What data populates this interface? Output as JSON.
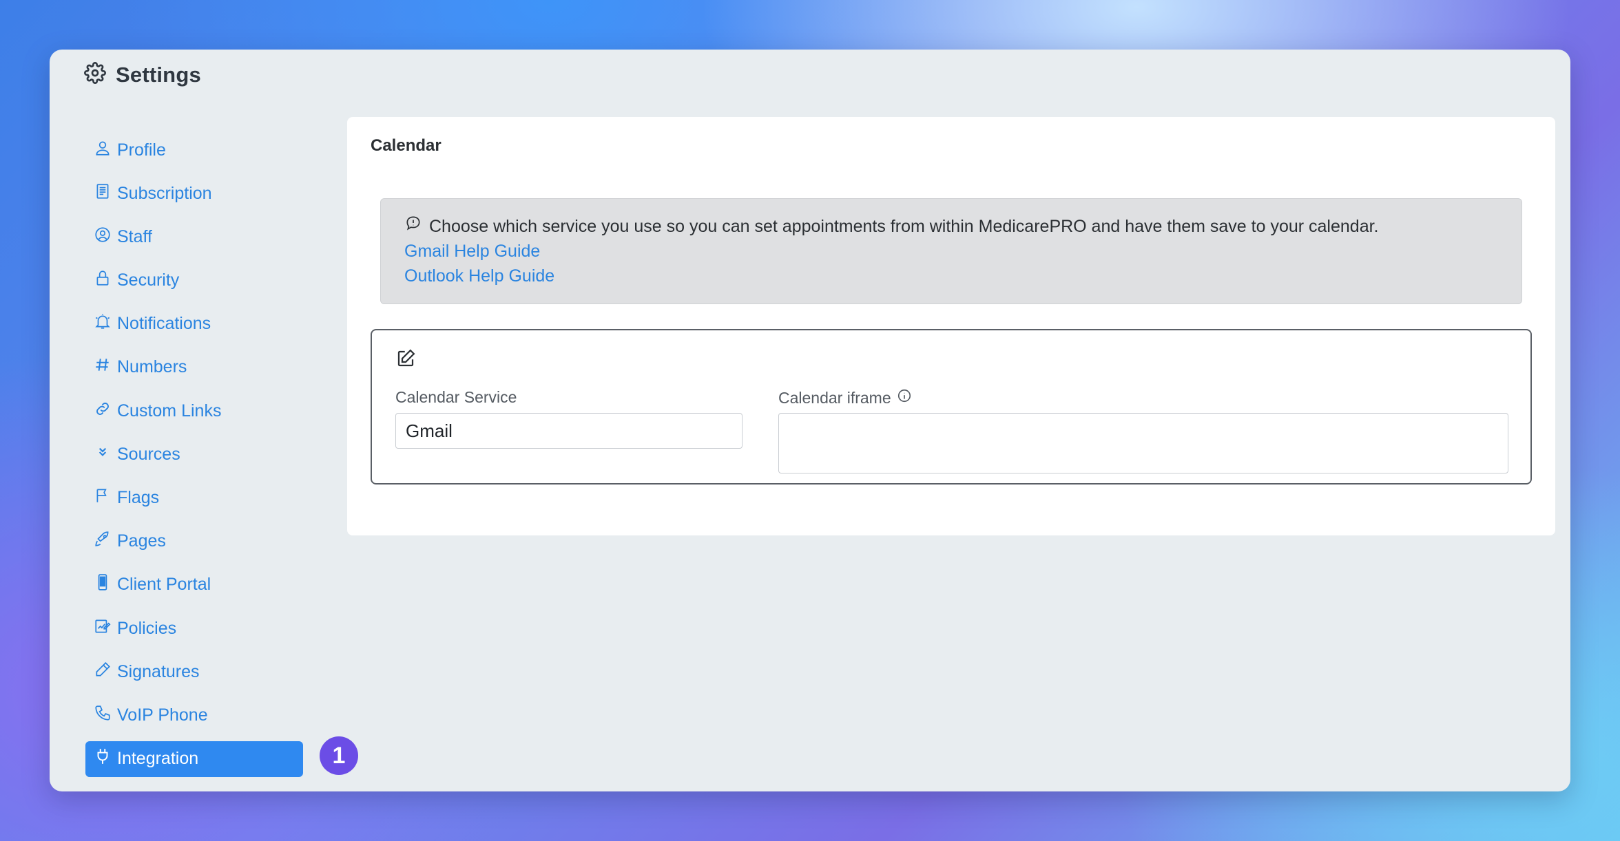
{
  "window": {
    "title": "Settings",
    "title_icon": "gear-icon"
  },
  "sidebar": {
    "items": [
      {
        "label": "Profile",
        "icon": "user-icon"
      },
      {
        "label": "Subscription",
        "icon": "receipt-icon"
      },
      {
        "label": "Staff",
        "icon": "user-circle-icon"
      },
      {
        "label": "Security",
        "icon": "lock-icon"
      },
      {
        "label": "Notifications",
        "icon": "bell-icon"
      },
      {
        "label": "Numbers",
        "icon": "hash-icon"
      },
      {
        "label": "Custom Links",
        "icon": "link-icon"
      },
      {
        "label": "Sources",
        "icon": "chevrons-down-icon"
      },
      {
        "label": "Flags",
        "icon": "flag-icon"
      },
      {
        "label": "Pages",
        "icon": "rocket-icon"
      },
      {
        "label": "Client Portal",
        "icon": "phone-device-icon"
      },
      {
        "label": "Policies",
        "icon": "policy-edit-icon"
      },
      {
        "label": "Signatures",
        "icon": "pen-icon"
      },
      {
        "label": "VoIP Phone",
        "icon": "phone-icon"
      },
      {
        "label": "Integration",
        "icon": "plug-icon",
        "active": true
      }
    ]
  },
  "step_badge": "1",
  "card": {
    "title": "Calendar",
    "info": {
      "icon": "chat-bubble-icon",
      "message": "Choose which service you use so you can set appointments from within MedicarePRO and have them save to your calendar.",
      "gmail_link": "Gmail Help Guide",
      "outlook_link": "Outlook Help Guide"
    },
    "form": {
      "edit_icon": "edit-icon",
      "service_label": "Calendar Service",
      "service_value": "Gmail",
      "iframe_label": "Calendar iframe",
      "iframe_info_icon": "info-icon",
      "iframe_value": ""
    }
  },
  "colors": {
    "accent": "#2a84e0",
    "active_bg": "#2f89f0",
    "badge": "#6b4de6",
    "window_bg": "#e8edf0"
  }
}
